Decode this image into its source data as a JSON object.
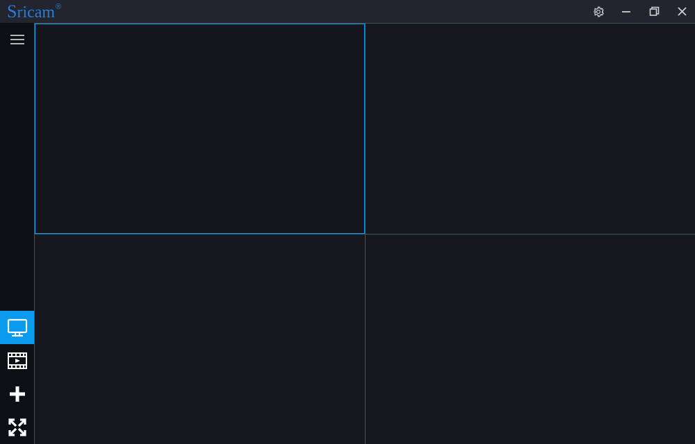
{
  "app": {
    "brand": "Sricam",
    "brand_trademark": "®"
  },
  "titlebar": {
    "settings_icon": "gear-icon",
    "minimize_icon": "minimize-icon",
    "maximize_icon": "maximize-restore-icon",
    "close_icon": "close-icon"
  },
  "sidebar": {
    "menu_icon": "hamburger-icon",
    "items": [
      {
        "id": "live-view",
        "icon": "monitor-icon",
        "active": true
      },
      {
        "id": "playback",
        "icon": "film-play-icon",
        "active": false
      },
      {
        "id": "add-device",
        "icon": "plus-icon",
        "active": false
      },
      {
        "id": "fullscreen",
        "icon": "expand-icon",
        "active": false
      }
    ]
  },
  "grid": {
    "layout": "2x2",
    "cells": [
      {
        "index": 0,
        "selected": true
      },
      {
        "index": 1,
        "selected": false
      },
      {
        "index": 2,
        "selected": false
      },
      {
        "index": 3,
        "selected": false
      }
    ]
  }
}
